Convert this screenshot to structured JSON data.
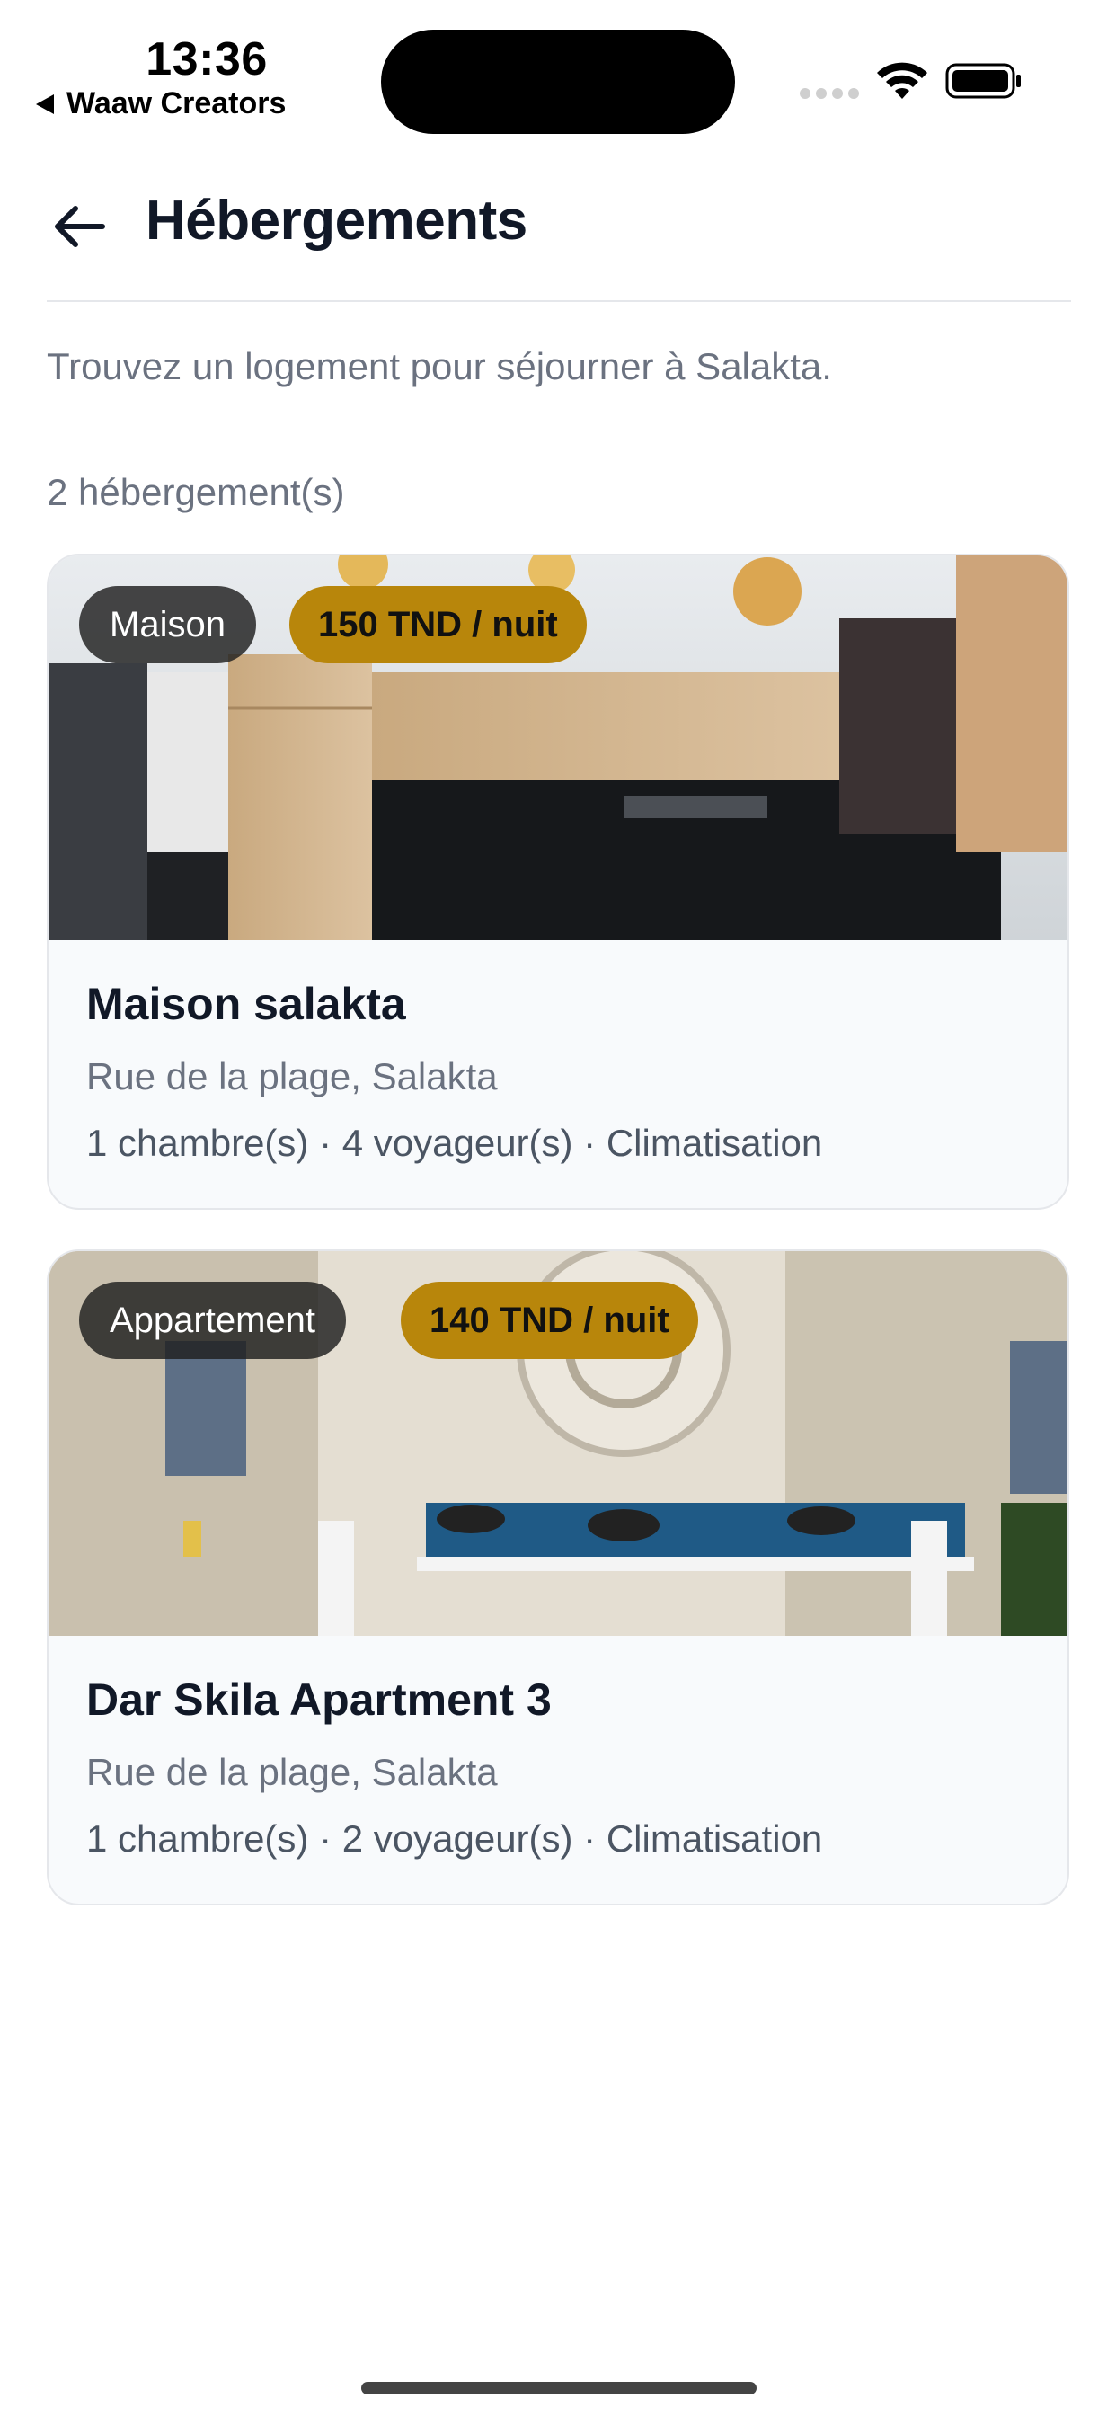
{
  "status_bar": {
    "time": "13:36",
    "back_app_label": "Waaw Creators",
    "icons": [
      "back-triangle-icon",
      "signal-icon",
      "wifi-icon",
      "battery-icon"
    ]
  },
  "header": {
    "title": "Hébergements",
    "back_icon": "arrow-left-icon"
  },
  "intro_text": "Trouvez un logement pour séjourner à Salakta.",
  "count_text": "2 hébergement(s)",
  "accent_colors": {
    "price_badge": "#b8860b",
    "type_badge": "#1e1e1e",
    "card_background": "#f8fafc"
  },
  "listings": [
    {
      "type": "Maison",
      "price": "150 TND / nuit",
      "title": "Maison salakta",
      "address": "Rue de la plage, Salakta",
      "meta": "1 chambre(s) · 4 voyageur(s) · Climatisation"
    },
    {
      "type": "Appartement",
      "price": "140 TND / nuit",
      "title": "Dar Skila Apartment 3",
      "address": "Rue de la plage, Salakta",
      "meta": "1 chambre(s) · 2 voyageur(s) · Climatisation"
    }
  ]
}
